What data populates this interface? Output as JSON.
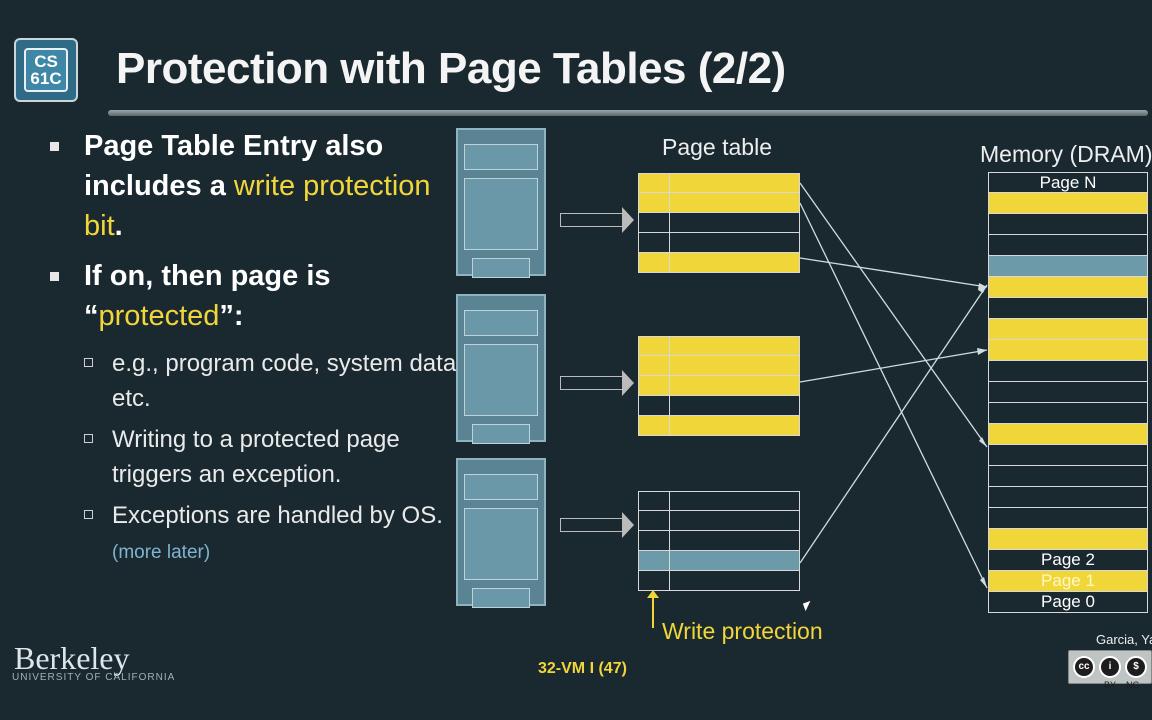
{
  "logo": {
    "line1": "CS",
    "line2": "61C"
  },
  "title": "Protection with Page Tables (2/2)",
  "bullets": {
    "b1_part1": "Page Table Entry also includes a ",
    "b1_highlight": "write protection bit",
    "b1_end": ".",
    "b2_part1": "If on, then page is “",
    "b2_highlight": "protected",
    "b2_end": "”:",
    "sub1": "e.g., program code, system data, etc.",
    "sub2": "Writing to a protected page triggers an exception.",
    "sub3": "Exceptions are handled by OS.",
    "sub3_note": "(more later)"
  },
  "diagram": {
    "page_table_label": "Page table",
    "memory_label": "Memory (DRAM)",
    "write_protection_label": "Write protection",
    "page_n": "Page N",
    "page_2": "Page 2",
    "page_1": "Page 1",
    "page_0": "Page 0",
    "colors": {
      "protected": "#f1d63a",
      "shared": "#6d9aa8"
    }
  },
  "footer": {
    "institution": "Berkeley",
    "institution_sub": "UNIVERSITY OF CALIFORNIA",
    "slide_ref": "32-VM I (47)",
    "author": "Garcia, Yan",
    "license_by": "BY",
    "license_nc": "NC"
  }
}
